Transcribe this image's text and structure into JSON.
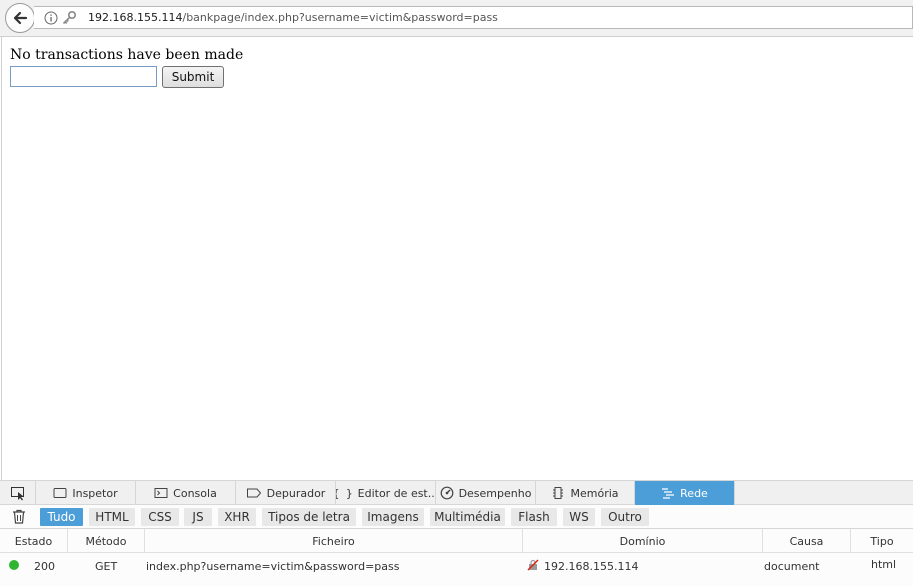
{
  "browser": {
    "url_host": "192.168.155.114",
    "url_path": "/bankpage/index.php?username=victim&password=pass"
  },
  "page": {
    "message": "No transactions have been made",
    "input_value": "",
    "submit_label": "Submit"
  },
  "devtools": {
    "tabs": [
      {
        "label": "Inspetor",
        "icon": "inspector-icon"
      },
      {
        "label": "Consola",
        "icon": "console-icon"
      },
      {
        "label": "Depurador",
        "icon": "debugger-icon"
      },
      {
        "label": "Editor de est...",
        "icon": "style-editor-icon"
      },
      {
        "label": "Desempenho",
        "icon": "performance-icon"
      },
      {
        "label": "Memória",
        "icon": "memory-icon"
      },
      {
        "label": "Rede",
        "icon": "network-icon",
        "selected": true
      }
    ],
    "filters": [
      "Tudo",
      "HTML",
      "CSS",
      "JS",
      "XHR",
      "Tipos de letra",
      "Imagens",
      "Multimédia",
      "Flash",
      "WS",
      "Outro"
    ],
    "selected_filter": "Tudo",
    "columns": [
      "Estado",
      "Método",
      "Ficheiro",
      "Domínio",
      "Causa",
      "Tipo"
    ],
    "requests": [
      {
        "status": "200",
        "method": "GET",
        "file": "index.php?username=victim&password=pass",
        "domain": "192.168.155.114",
        "cause": "document",
        "type": "html",
        "status_color": "#2fb52f"
      }
    ],
    "accent_color": "#4c9ed9"
  }
}
